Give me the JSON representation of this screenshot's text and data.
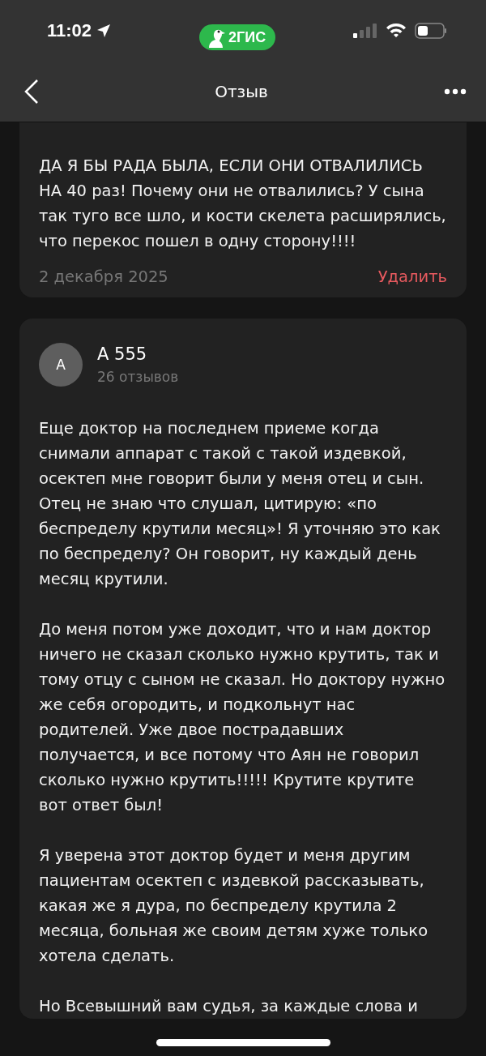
{
  "status_bar": {
    "time": "11:02",
    "app_badge": "2ГИС"
  },
  "header": {
    "title": "Отзыв"
  },
  "reviews": [
    {
      "paragraphs": [
        "ДА Я БЫ РАДА БЫЛА, ЕСЛИ ОНИ ОТВАЛИЛИСЬ НА 40 раз! Почему они не отвалились? У сына так туго все шло, и кости скелета расширялись, что перекос пошел в одну сторону!!!!"
      ],
      "date": "2 декабря 2025",
      "action": "Удалить"
    },
    {
      "author": {
        "initial": "А",
        "name": "А 555",
        "reviews_count": "26 отзывов"
      },
      "paragraphs": [
        "Еще доктор на последнем приеме когда снимали аппарат с такой с такой издевкой, осектеп мне говорит были у меня отец и сын. Отец не знаю что слушал, цитирую: «по беспределу крутили месяц»! Я уточняю это как по беспределу? Он говорит, ну каждый день месяц крутили.",
        "До меня потом уже доходит, что и нам доктор ничего не сказал сколько нужно крутить, так и тому отцу с сыном не сказал. Но доктору нужно же себя огородить, и подкольнут нас родителей. Уже двое пострадавших получается, и все потому что Аян не говорил сколько нужно крутить!!!!! Крутите крутите вот ответ был!",
        "Я уверена этот доктор будет и меня другим пациентам осектеп с издевкой рассказывать, какая же я дура, по беспределу крутила 2 месяца, больная же своим детям хуже только хотела сделать.",
        "Но Всевышний вам судья, за каждые слова и"
      ]
    }
  ]
}
